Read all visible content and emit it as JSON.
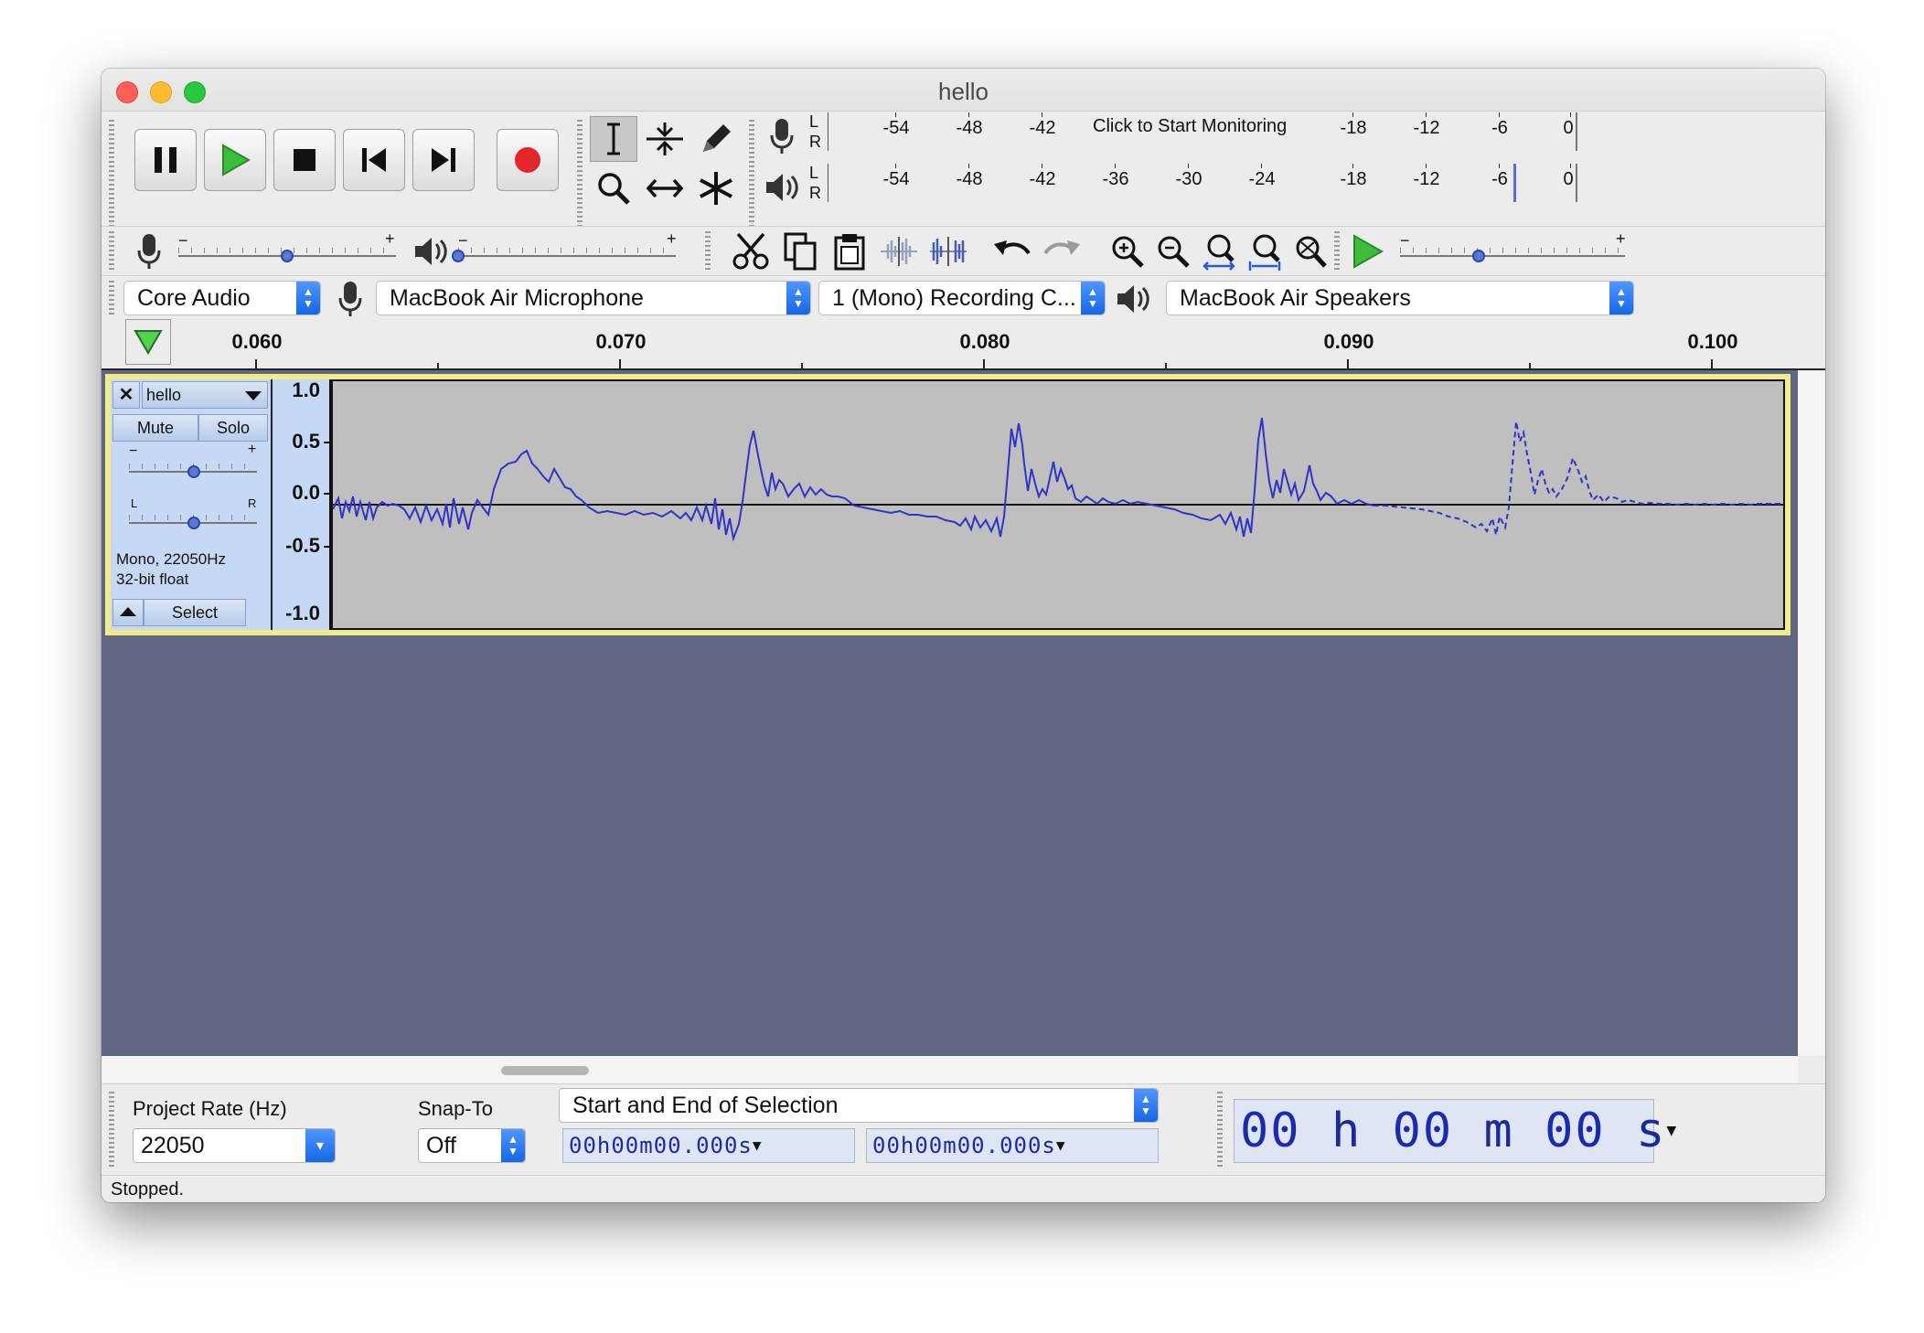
{
  "window": {
    "title": "hello"
  },
  "transport": {
    "buttons": [
      "pause",
      "play",
      "stop",
      "skip-to-start",
      "skip-to-end",
      "record"
    ]
  },
  "tools": [
    "selection",
    "envelope",
    "draw",
    "zoom",
    "time-shift",
    "multi"
  ],
  "meters": {
    "record": {
      "channels": [
        "L",
        "R"
      ],
      "ticks": [
        "-54",
        "-48",
        "-42",
        "-18",
        "-12",
        "-6",
        "0"
      ],
      "monitor_text": "Click to Start Monitoring"
    },
    "playback": {
      "channels": [
        "L",
        "R"
      ],
      "ticks": [
        "-54",
        "-48",
        "-42",
        "-36",
        "-30",
        "-24",
        "-18",
        "-12",
        "-6",
        "0"
      ]
    }
  },
  "mixer": {
    "minus": "−",
    "plus": "+",
    "record_level": 0.5,
    "playback_level": 0.0
  },
  "play_at_speed": {
    "minus": "−",
    "plus": "+",
    "level": 0.35
  },
  "devices": {
    "host": "Core Audio",
    "input": "MacBook Air Microphone",
    "channels": "1 (Mono) Recording C...",
    "output": "MacBook Air Speakers"
  },
  "ruler": {
    "labels": [
      "0.060",
      "0.070",
      "0.080",
      "0.090",
      "0.100"
    ]
  },
  "track": {
    "name": "hello",
    "mute": "Mute",
    "solo": "Solo",
    "gain_minus": "−",
    "gain_plus": "+",
    "pan_left": "L",
    "pan_right": "R",
    "info_line1": "Mono, 22050Hz",
    "info_line2": "32-bit float",
    "select": "Select",
    "vruler": [
      "1.0",
      "0.5",
      "0.0",
      "-0.5",
      "-1.0"
    ],
    "waveform_color": "#3232c8"
  },
  "selection_bar": {
    "project_rate_label": "Project Rate (Hz)",
    "project_rate": "22050",
    "snap_label": "Snap-To",
    "snap_value": "Off",
    "selection_mode": "Start and End of Selection",
    "start": {
      "h": "00",
      "m": "00",
      "s": "00.000",
      "hu": "h",
      "mu": "m",
      "su": "s"
    },
    "end": {
      "h": "00",
      "m": "00",
      "s": "00.000",
      "hu": "h",
      "mu": "m",
      "su": "s"
    },
    "audio_position": {
      "h": "00",
      "m": "00",
      "s": "00",
      "hu": "h",
      "mu": "m",
      "su": "s"
    }
  },
  "status": "Stopped."
}
